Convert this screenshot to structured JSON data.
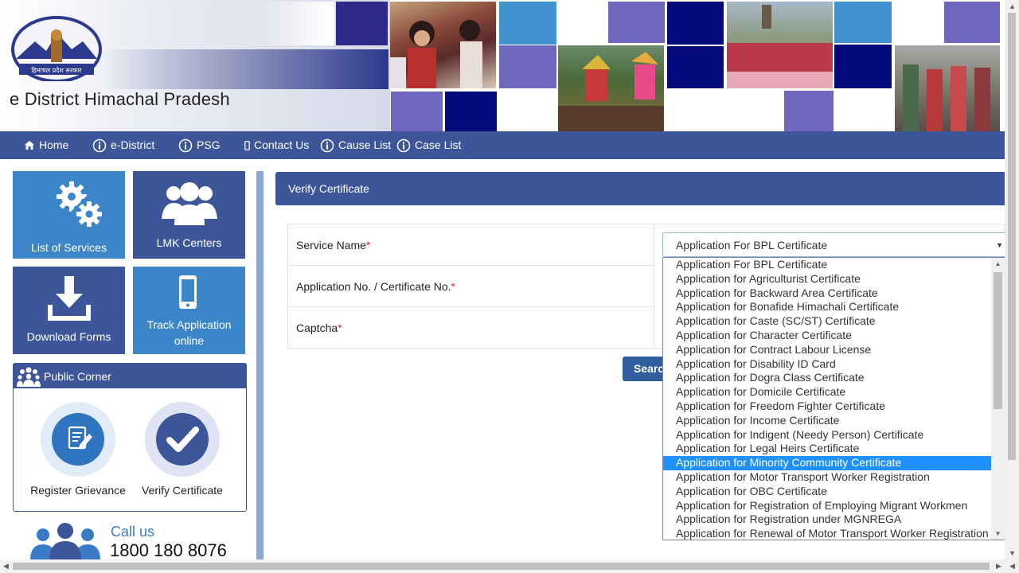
{
  "header": {
    "title": "e District Himachal Pradesh",
    "logo_text": "हिमाचल प्रदेश सरकार"
  },
  "nav": {
    "items": [
      {
        "label": "Home",
        "icon": "home-icon"
      },
      {
        "label": "e-District",
        "icon": "info-icon"
      },
      {
        "label": "PSG",
        "icon": "info-icon"
      },
      {
        "label": "Contact Us",
        "icon": "phone-icon"
      },
      {
        "label": "Cause List",
        "icon": "info-icon"
      },
      {
        "label": "Case List",
        "icon": "info-icon"
      }
    ]
  },
  "sidebar": {
    "tiles": [
      {
        "label": "List of Services",
        "icon": "gears-icon"
      },
      {
        "label": "LMK Centers",
        "icon": "group-icon"
      },
      {
        "label": "Download Forms",
        "icon": "download-icon"
      },
      {
        "label_line1": "Track Application",
        "label_line2": "online",
        "icon": "mobile-icon"
      }
    ],
    "public_corner": {
      "title": "Public Corner",
      "items": [
        {
          "label": "Register Grievance",
          "icon": "edit-icon"
        },
        {
          "label": "Verify Certificate",
          "icon": "check-icon"
        }
      ]
    },
    "call": {
      "title": "Call us",
      "number": "1800 180 8076"
    }
  },
  "main": {
    "heading": "Verify Certificate",
    "fields": [
      {
        "label": "Service Name",
        "required": "*"
      },
      {
        "label": "Application No. / Certificate No.",
        "required": "*"
      },
      {
        "label": "Captcha",
        "required": "*"
      }
    ],
    "service_select_value": "Application For BPL Certificate",
    "search_label": "Search",
    "dropdown_options": [
      "Application For BPL Certificate",
      "Application for Agriculturist Certificate",
      "Application for Backward Area Certificate",
      "Application for Bonafide Himachali Certificate",
      "Application for Caste (SC/ST) Certificate",
      "Application for Character Certificate",
      "Application for Contract Labour License",
      "Application for Disability ID Card",
      "Application for Dogra Class Certificate",
      "Application for Domicile Certificate",
      "Application for Freedom Fighter Certificate",
      "Application for Income Certificate",
      "Application for Indigent (Needy Person) Certificate",
      "Application for Legal Heirs Certificate",
      "Application for Minority Community Certificate",
      "Application for Motor Transport Worker Registration",
      "Application for OBC Certificate",
      "Application for Registration of Employing Migrant Workmen",
      "Application for Registration under MGNREGA",
      "Application for Renewal of Motor Transport Worker Registration"
    ],
    "highlighted_option": "Application for Minority Community Certificate"
  },
  "colors": {
    "primary": "#3d5699",
    "tile_light": "#3a86c8",
    "highlight": "#1e90ff",
    "required": "#d9232e",
    "call_title": "#3a7bc8"
  }
}
